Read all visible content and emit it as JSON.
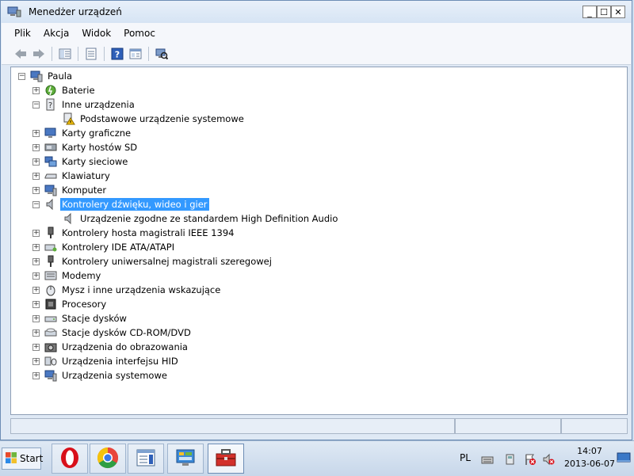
{
  "window": {
    "title": "Menedżer urządzeń",
    "controls": {
      "minimize": "_",
      "maximize": "☐",
      "close": "✕"
    }
  },
  "menu": [
    "Plik",
    "Akcja",
    "Widok",
    "Pomoc"
  ],
  "toolbar": {
    "buttons": [
      "back-icon",
      "forward-icon",
      "console-tree-icon",
      "properties-icon",
      "help-icon",
      "view-icon",
      "scan-hardware-icon"
    ]
  },
  "tree": {
    "root": "Paula",
    "items": [
      {
        "label": "Baterie",
        "expander": "+",
        "icon": "battery-icon"
      },
      {
        "label": "Inne urządzenia",
        "expander": "−",
        "icon": "unknown-device-icon"
      },
      {
        "label": "Podstawowe urządzenie systemowe",
        "expander": "",
        "icon": "warning-device-icon",
        "child": true
      },
      {
        "label": "Karty graficzne",
        "expander": "+",
        "icon": "display-adapter-icon"
      },
      {
        "label": "Karty hostów SD",
        "expander": "+",
        "icon": "sd-host-icon"
      },
      {
        "label": "Karty sieciowe",
        "expander": "+",
        "icon": "network-adapter-icon"
      },
      {
        "label": "Klawiatury",
        "expander": "+",
        "icon": "keyboard-icon"
      },
      {
        "label": "Komputer",
        "expander": "+",
        "icon": "computer-icon"
      },
      {
        "label": "Kontrolery dźwięku, wideo i gier",
        "expander": "−",
        "icon": "speaker-icon",
        "selected": true
      },
      {
        "label": "Urządzenie zgodne ze standardem High Definition Audio",
        "expander": "",
        "icon": "speaker-icon",
        "child": true
      },
      {
        "label": "Kontrolery hosta magistrali IEEE 1394",
        "expander": "+",
        "icon": "firewire-icon"
      },
      {
        "label": "Kontrolery IDE ATA/ATAPI",
        "expander": "+",
        "icon": "ide-controller-icon"
      },
      {
        "label": "Kontrolery uniwersalnej magistrali szeregowej",
        "expander": "+",
        "icon": "usb-icon"
      },
      {
        "label": "Modemy",
        "expander": "+",
        "icon": "modem-icon"
      },
      {
        "label": "Mysz i inne urządzenia wskazujące",
        "expander": "+",
        "icon": "mouse-icon"
      },
      {
        "label": "Procesory",
        "expander": "+",
        "icon": "processor-icon"
      },
      {
        "label": "Stacje dysków",
        "expander": "+",
        "icon": "disk-drive-icon"
      },
      {
        "label": "Stacje dysków CD-ROM/DVD",
        "expander": "+",
        "icon": "cdrom-icon"
      },
      {
        "label": "Urządzenia do obrazowania",
        "expander": "+",
        "icon": "imaging-device-icon"
      },
      {
        "label": "Urządzenia interfejsu HID",
        "expander": "+",
        "icon": "hid-icon"
      },
      {
        "label": "Urządzenia systemowe",
        "expander": "+",
        "icon": "system-device-icon"
      }
    ]
  },
  "taskbar": {
    "start_label": "Start",
    "apps": [
      "opera-icon",
      "chrome-icon",
      "notepad-icon",
      "control-panel-icon",
      "toolbox-icon"
    ],
    "tray": {
      "language": "PL",
      "time": "14:07",
      "date": "2013-06-07"
    }
  },
  "colors": {
    "selection": "#3399ff",
    "window_frame": "#dfe9f5",
    "taskbar": "#c7d7ea"
  }
}
